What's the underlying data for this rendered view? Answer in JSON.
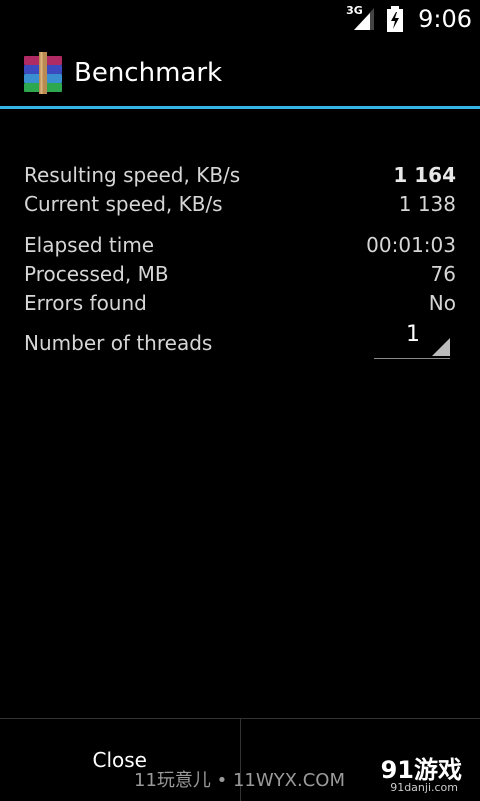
{
  "status_bar": {
    "network": "3G",
    "time": "9:06"
  },
  "action_bar": {
    "title": "Benchmark",
    "icon": "winrar-books-icon"
  },
  "stats": {
    "resulting_speed": {
      "label": "Resulting speed, KB/s",
      "value": "1 164"
    },
    "current_speed": {
      "label": "Current speed, KB/s",
      "value": "1 138"
    },
    "elapsed_time": {
      "label": "Elapsed time",
      "value": "00:01:03"
    },
    "processed": {
      "label": "Processed, MB",
      "value": "76"
    },
    "errors": {
      "label": "Errors found",
      "value": "No"
    },
    "threads": {
      "label": "Number of threads",
      "value": "1"
    }
  },
  "bottom_bar": {
    "close_label": "Close"
  },
  "watermarks": {
    "left_text": "11玩意儿 • 11WYX.COM",
    "logo_text": "91游戏",
    "logo_sub": "91danji.com"
  },
  "colors": {
    "accent": "#33b5e5",
    "background": "#000000",
    "text": "#d6d6d6"
  }
}
